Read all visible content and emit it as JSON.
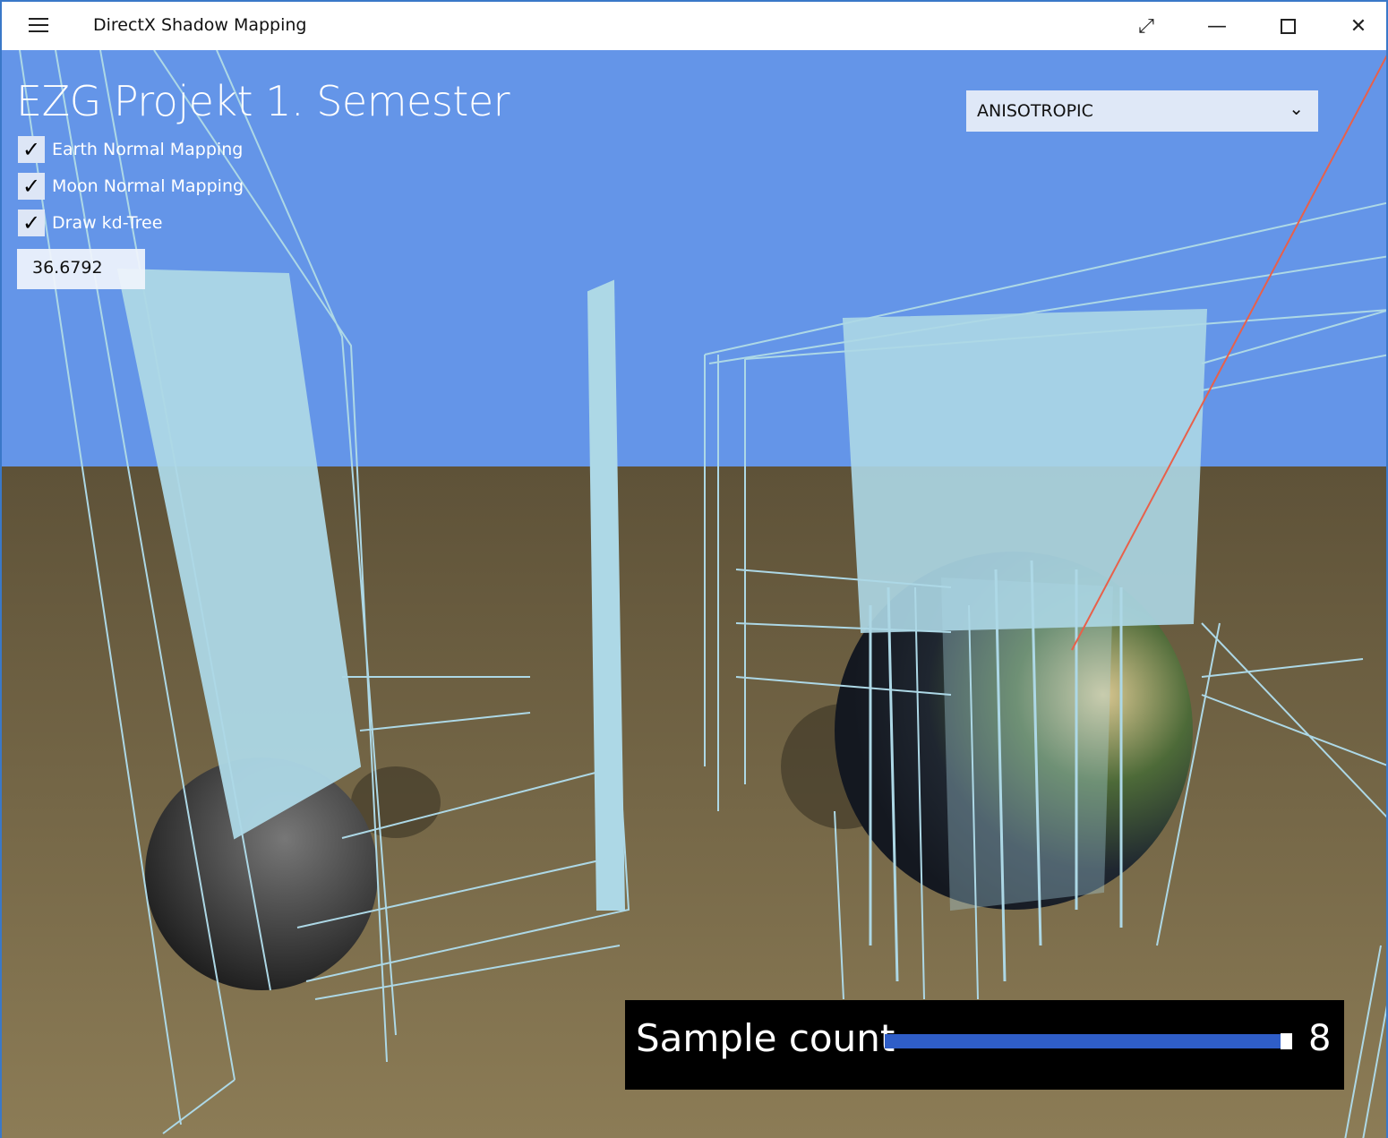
{
  "window": {
    "title": "DirectX Shadow Mapping",
    "controls": [
      "fullscreen",
      "minimize",
      "maximize",
      "close"
    ]
  },
  "overlay": {
    "heading": "EZG Projekt 1. Semester",
    "checkboxes": [
      {
        "label": "Earth Normal Mapping",
        "checked": true
      },
      {
        "label": "Moon Normal Mapping",
        "checked": true
      },
      {
        "label": "Draw kd-Tree",
        "checked": true
      }
    ],
    "value_field": "36.6792",
    "filter_dropdown": {
      "selected": "ANISOTROPIC"
    },
    "sample_count": {
      "label": "Sample count",
      "value": "8",
      "fraction": 1.0
    }
  },
  "colors": {
    "sky": "#6495e8",
    "ground": "#7d6d4c",
    "wireframe": "#add8e6",
    "slider": "#2f5ec8",
    "light_ray": "#e8604a"
  }
}
